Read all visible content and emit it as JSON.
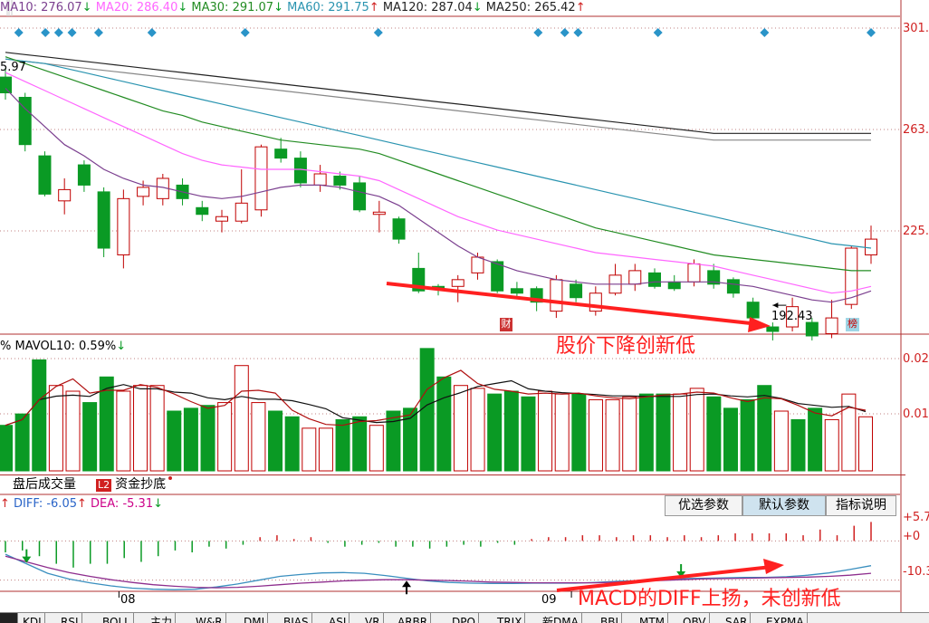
{
  "colors": {
    "up": "#c00000",
    "down": "#0a9a24",
    "ma10": "#7b3f8f",
    "ma20": "#ff66ff",
    "ma30": "#238c23",
    "ma60": "#2a94b0",
    "ma120": "#222222",
    "ma250": "#888888",
    "annotation": "#ff2020",
    "label_red": "#d02020",
    "label_blue": "#2a64c8",
    "label_magenta": "#cc0088"
  },
  "top_bar": {
    "ma10": "MA10: 276.07",
    "ma10_arrow": "↓",
    "ma20": "MA20: 286.40",
    "ma20_arrow": "↓",
    "ma30": "MA30: 291.07",
    "ma30_arrow": "↓",
    "ma60": "MA60: 291.75",
    "ma60_arrow": "↑",
    "ma120": "MA120: 287.04",
    "ma120_arrow": "↓",
    "ma250": "MA250: 265.42",
    "ma250_arrow": "↑"
  },
  "price_axis": [
    "301.",
    "263.",
    "225."
  ],
  "volume_axis": [
    "0.02",
    "0.01"
  ],
  "macd_axis": [
    "+5.7",
    "+0",
    "-10.3"
  ],
  "left_cut_label": "5.97",
  "low_label": "192.43",
  "event_labels": [
    "财",
    "榜"
  ],
  "volume_bar": {
    "pct": "%",
    "mavol": "MAVOL10: 0.59%",
    "mavol_arrow": "↓"
  },
  "tabs": {
    "after_hours": "盘后成交量",
    "capital_badge": "L2",
    "capital": "资金抄底"
  },
  "macd_bar": {
    "diff": "DIFF: -6.05",
    "diff_arrow": "↑",
    "dea": "DEA: -5.31",
    "dea_arrow": "↓"
  },
  "param_buttons": [
    "优选参数",
    "默认参数",
    "指标说明"
  ],
  "date_labels": [
    "08",
    "09"
  ],
  "annotations": {
    "price": "股价下降创新低",
    "macd": "MACD的DIFF上扬，未创新低"
  },
  "indicator_tabs": [
    "KDJ",
    "RSI",
    "BOLL",
    "主力",
    "W&R",
    "DMI",
    "BIAS",
    "ASI",
    "VR",
    "ARBR",
    "DPO",
    "TRIX",
    "新DMA",
    "BBI",
    "MTM",
    "OBV",
    "SAR",
    "EXPMA"
  ],
  "chart_data": {
    "type": "candlestick",
    "y_range_price": [
      180,
      320
    ],
    "y_range_volume": [
      0,
      0.021
    ],
    "y_range_macd": [
      -13,
      7
    ],
    "date_labels": [
      {
        "index": 6,
        "text": "08"
      },
      {
        "index": 29,
        "text": "09"
      }
    ],
    "candles": [
      {
        "o": 293,
        "c": 286,
        "h": 297,
        "l": 283
      },
      {
        "o": 284,
        "c": 263,
        "h": 286,
        "l": 260
      },
      {
        "o": 258,
        "c": 241,
        "h": 260,
        "l": 240
      },
      {
        "o": 238,
        "c": 243,
        "h": 248,
        "l": 232
      },
      {
        "o": 254,
        "c": 245,
        "h": 256,
        "l": 242
      },
      {
        "o": 242,
        "c": 217,
        "h": 244,
        "l": 213
      },
      {
        "o": 214,
        "c": 239,
        "h": 243,
        "l": 208
      },
      {
        "o": 240,
        "c": 244,
        "h": 247,
        "l": 236
      },
      {
        "o": 239,
        "c": 248,
        "h": 250,
        "l": 236
      },
      {
        "o": 245,
        "c": 239,
        "h": 248,
        "l": 236
      },
      {
        "o": 235,
        "c": 232,
        "h": 238,
        "l": 229
      },
      {
        "o": 229,
        "c": 231,
        "h": 234,
        "l": 224
      },
      {
        "o": 229,
        "c": 237,
        "h": 252,
        "l": 228
      },
      {
        "o": 234,
        "c": 262,
        "h": 263,
        "l": 231
      },
      {
        "o": 261,
        "c": 257,
        "h": 266,
        "l": 255
      },
      {
        "o": 257,
        "c": 246,
        "h": 260,
        "l": 244
      },
      {
        "o": 245,
        "c": 250,
        "h": 254,
        "l": 242
      },
      {
        "o": 249,
        "c": 245,
        "h": 251,
        "l": 243
      },
      {
        "o": 246,
        "c": 234,
        "h": 249,
        "l": 233
      },
      {
        "o": 232,
        "c": 233,
        "h": 238,
        "l": 224
      },
      {
        "o": 230,
        "c": 221,
        "h": 231,
        "l": 219
      },
      {
        "o": 208,
        "c": 198,
        "h": 215,
        "l": 197
      },
      {
        "o": 200,
        "c": 199,
        "h": 201,
        "l": 196
      },
      {
        "o": 200,
        "c": 203,
        "h": 205,
        "l": 193
      },
      {
        "o": 206,
        "c": 213,
        "h": 215,
        "l": 203
      },
      {
        "o": 211,
        "c": 198,
        "h": 212,
        "l": 197
      },
      {
        "o": 199,
        "c": 197,
        "h": 202,
        "l": 195
      },
      {
        "o": 199,
        "c": 193,
        "h": 200,
        "l": 189
      },
      {
        "o": 189,
        "c": 203,
        "h": 205,
        "l": 186
      },
      {
        "o": 201,
        "c": 195,
        "h": 203,
        "l": 193
      },
      {
        "o": 189,
        "c": 197,
        "h": 200,
        "l": 187
      },
      {
        "o": 197,
        "c": 205,
        "h": 210,
        "l": 196
      },
      {
        "o": 201,
        "c": 207,
        "h": 210,
        "l": 198
      },
      {
        "o": 206,
        "c": 200,
        "h": 208,
        "l": 199
      },
      {
        "o": 202,
        "c": 199,
        "h": 205,
        "l": 198
      },
      {
        "o": 202,
        "c": 210,
        "h": 212,
        "l": 200
      },
      {
        "o": 207,
        "c": 201,
        "h": 210,
        "l": 199
      },
      {
        "o": 203,
        "c": 197,
        "h": 204,
        "l": 195
      },
      {
        "o": 193,
        "c": 186,
        "h": 195,
        "l": 185
      },
      {
        "o": 182,
        "c": 180,
        "h": 184,
        "l": 176
      },
      {
        "o": 182,
        "c": 191,
        "h": 195,
        "l": 180
      },
      {
        "o": 184,
        "c": 178,
        "h": 186,
        "l": 176
      },
      {
        "o": 179,
        "c": 186,
        "h": 194,
        "l": 177
      },
      {
        "o": 192,
        "c": 217,
        "h": 218,
        "l": 190
      },
      {
        "o": 214,
        "c": 221,
        "h": 227,
        "l": 210
      }
    ],
    "volume": [
      0.008,
      0.01,
      0.0195,
      0.015,
      0.014,
      0.012,
      0.0165,
      0.014,
      0.015,
      0.015,
      0.0105,
      0.011,
      0.0115,
      0.012,
      0.0185,
      0.012,
      0.0105,
      0.0095,
      0.0075,
      0.0075,
      0.009,
      0.0095,
      0.008,
      0.0105,
      0.011,
      0.0215,
      0.0165,
      0.015,
      0.0145,
      0.0135,
      0.014,
      0.013,
      0.014,
      0.0135,
      0.0135,
      0.0125,
      0.0125,
      0.013,
      0.0135,
      0.0135,
      0.0135,
      0.0145,
      0.013,
      0.011,
      0.0125,
      0.015,
      0.0105,
      0.009,
      0.011,
      0.009,
      0.0135,
      0.0095
    ],
    "ma10": [
      288,
      279,
      271,
      263,
      258,
      252,
      248,
      245,
      244,
      242,
      240,
      239,
      240,
      242,
      244,
      245,
      245,
      244,
      242,
      240,
      236,
      230,
      224,
      218,
      213,
      210,
      207,
      205,
      203,
      202,
      201,
      201,
      201,
      202,
      202,
      202,
      202,
      201,
      200,
      198,
      196,
      194,
      193,
      195,
      198
    ],
    "ma20": [
      295,
      291,
      287,
      283,
      279,
      275,
      271,
      267,
      263,
      259,
      256,
      254,
      253,
      252,
      252,
      252,
      251,
      250,
      249,
      247,
      243,
      239,
      235,
      231,
      228,
      225,
      223,
      221,
      219,
      217,
      215,
      214,
      213,
      212,
      211,
      210,
      209,
      207,
      205,
      203,
      201,
      199,
      197,
      198,
      200
    ],
    "ma30": [
      302,
      299,
      296,
      293,
      290,
      287,
      284,
      281,
      278,
      276,
      273,
      271,
      269,
      267,
      265,
      264,
      263,
      262,
      261,
      259,
      256,
      253,
      250,
      247,
      244,
      241,
      238,
      235,
      232,
      229,
      226,
      224,
      222,
      220,
      218,
      216,
      214,
      213,
      212,
      211,
      210,
      209,
      208,
      207,
      207
    ],
    "ma60": [
      301,
      300,
      299,
      297,
      295,
      293,
      291,
      289,
      287,
      285,
      283,
      281,
      279,
      277,
      275,
      273,
      271,
      269,
      267,
      265,
      263,
      261,
      259,
      257,
      255,
      253,
      251,
      249,
      247,
      245,
      243,
      241,
      239,
      237,
      235,
      233,
      231,
      229,
      227,
      225,
      223,
      221,
      219,
      218,
      217
    ],
    "ma120": [
      304,
      303,
      302,
      301,
      300,
      299,
      298,
      297,
      296,
      295,
      294,
      293,
      292,
      291,
      290,
      289,
      288,
      287,
      286,
      285,
      284,
      283,
      282,
      281,
      280,
      279,
      278,
      277,
      276,
      275,
      274,
      273,
      272,
      271,
      270,
      269,
      268,
      268,
      268,
      268,
      268,
      268,
      268,
      268,
      268
    ],
    "ma250": [
      301,
      300,
      299,
      298,
      297,
      296,
      295,
      294,
      293,
      292,
      291,
      290,
      289,
      288,
      287,
      286,
      285,
      284,
      283,
      282,
      281,
      280,
      279,
      278,
      277,
      276,
      275,
      274,
      273,
      272,
      271,
      270,
      269,
      268,
      267,
      266,
      265,
      265,
      265,
      265,
      265,
      265,
      265,
      265,
      265
    ],
    "macd_hist": [
      -3.0,
      -2.5,
      -4.0,
      -6.0,
      -7.0,
      -6.0,
      -6.0,
      -4.5,
      -5.5,
      -4.0,
      -2.5,
      -3.0,
      -1.5,
      -2.0,
      -1.0,
      1.0,
      1.5,
      0.5,
      1.0,
      -0.5,
      -1.5,
      -1.0,
      -0.5,
      -1.5,
      -1.5,
      -2.0,
      -1.5,
      -1.0,
      -1.5,
      -0.5,
      -1.0,
      0.5,
      1.0,
      1.0,
      1.5,
      1.5,
      1.0,
      1.5,
      1.5,
      1.0,
      1.5,
      1.0,
      1.5,
      2.0,
      2.0,
      2.0,
      2.0,
      1.5,
      3.0,
      1.5,
      4.0,
      5.0
    ],
    "diff": [
      -3.5,
      -6.0,
      -8.5,
      -10.0,
      -11.0,
      -11.8,
      -12.4,
      -12.7,
      -12.8,
      -12.7,
      -12.1,
      -11.3,
      -10.3,
      -9.3,
      -8.8,
      -8.4,
      -8.3,
      -8.5,
      -9.1,
      -9.8,
      -10.5,
      -10.9,
      -11.1,
      -11.2,
      -11.2,
      -11.1,
      -11.1,
      -11.1,
      -10.9,
      -10.6,
      -10.4,
      -10.1,
      -9.9,
      -9.8,
      -9.7,
      -9.6,
      -9.6,
      -9.4,
      -9.0,
      -8.4,
      -7.5,
      -6.5
    ],
    "dea": [
      -4.0,
      -5.5,
      -7.0,
      -8.3,
      -9.3,
      -10.2,
      -10.9,
      -11.5,
      -11.9,
      -12.2,
      -12.3,
      -12.2,
      -11.9,
      -11.5,
      -11.1,
      -10.8,
      -10.5,
      -10.3,
      -10.2,
      -10.2,
      -10.3,
      -10.4,
      -10.6,
      -10.8,
      -10.9,
      -11.0,
      -11.0,
      -11.0,
      -11.0,
      -10.8,
      -10.6,
      -10.4,
      -10.2,
      -10.0,
      -9.9,
      -9.8,
      -9.7,
      -9.6,
      -9.5,
      -9.3,
      -9.0,
      -8.5
    ],
    "diamond_columns": [
      1,
      3,
      4,
      5,
      7,
      11,
      18,
      28,
      40,
      42,
      43,
      49,
      57,
      65
    ],
    "macd_markers": [
      {
        "index": 1,
        "kind": "down"
      },
      {
        "index": 19,
        "kind": "up"
      },
      {
        "index": 32,
        "kind": "down"
      },
      {
        "index": 47,
        "kind": "up"
      }
    ],
    "low_point": {
      "index": 39,
      "value": 192.43
    },
    "event_markers": [
      {
        "index": 26,
        "text": "财"
      },
      {
        "index": 43,
        "text": "榜"
      }
    ]
  }
}
